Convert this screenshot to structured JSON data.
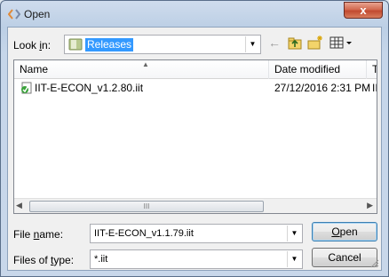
{
  "window": {
    "title": "Open",
    "close_label": "x"
  },
  "toolbar": {
    "lookin_label_pre": "Look ",
    "lookin_label_accel": "i",
    "lookin_label_post": "n:",
    "lookin_value": "Releases",
    "back_icon": "←",
    "up_icon": "up-folder-icon",
    "new_folder_icon": "new-folder-icon",
    "views_icon": "views-menu-icon"
  },
  "list": {
    "columns": [
      "Name",
      "Date modified",
      "Ty"
    ],
    "rows": [
      {
        "name": "IIT-E-ECON_v1.2.80.iit",
        "date": "27/12/2016 2:31 PM",
        "type": "II"
      }
    ],
    "scroll_grip": "III"
  },
  "form": {
    "filename_label_pre": "File ",
    "filename_label_accel": "n",
    "filename_label_post": "ame:",
    "filename_value": "IIT-E-ECON_v1.1.79.iit",
    "filetype_label_pre": "Files of ",
    "filetype_label_accel": "t",
    "filetype_label_post": "ype:",
    "filetype_value": "*.iit",
    "open_label_accel": "O",
    "open_label_post": "pen",
    "cancel_label": "Cancel"
  },
  "colors": {
    "selection": "#3399ff",
    "close_button": "#c14a30",
    "frame": "#bccfe5"
  }
}
